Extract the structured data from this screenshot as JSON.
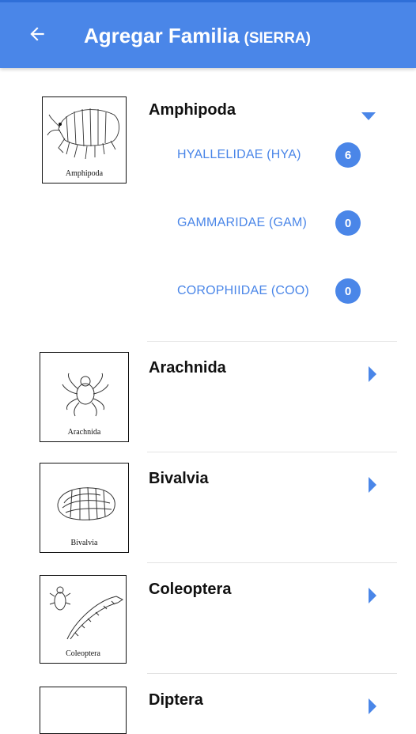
{
  "header": {
    "title": "Agregar Familia",
    "subtitle": "(SIERRA)",
    "back_icon": "arrow-back-icon",
    "bg_color": "#4a86e8"
  },
  "groups": [
    {
      "name": "Amphipoda",
      "image_caption": "Amphipoda",
      "expanded": true,
      "families": [
        {
          "label": "HYALLELIDAE (HYA)",
          "count": "6"
        },
        {
          "label": "GAMMARIDAE (GAM)",
          "count": "0"
        },
        {
          "label": "COROPHIIDAE (COO)",
          "count": "0"
        }
      ]
    },
    {
      "name": "Arachnida",
      "image_caption": "Arachnida",
      "expanded": false
    },
    {
      "name": "Bivalvia",
      "image_caption": "Bivalvia",
      "expanded": false
    },
    {
      "name": "Coleoptera",
      "image_caption": "Coleoptera",
      "expanded": false
    },
    {
      "name": "Diptera",
      "image_caption": "",
      "expanded": false
    }
  ],
  "colors": {
    "accent": "#4a86e8",
    "divider": "#e3e3e3"
  }
}
